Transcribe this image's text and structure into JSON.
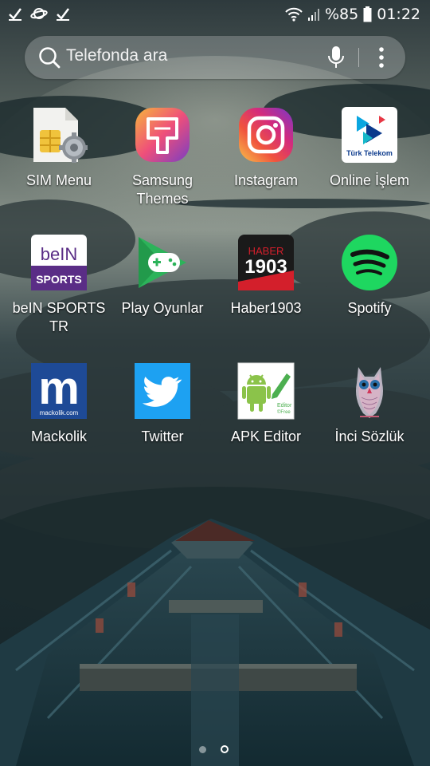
{
  "status_bar": {
    "notification_icons": [
      "check-icon",
      "planet-icon",
      "check-icon"
    ],
    "battery_percent": "%85",
    "time": "01:22"
  },
  "search": {
    "placeholder": "Telefonda ara"
  },
  "apps": [
    {
      "label": "SIM Menu",
      "icon": "sim-card-gear-icon"
    },
    {
      "label": "Samsung\nThemes",
      "icon": "paint-brush-icon"
    },
    {
      "label": "Instagram",
      "icon": "instagram-camera-icon"
    },
    {
      "label": "Online İşlem",
      "icon": "turk-telekom-logo-icon"
    },
    {
      "label": "beIN SPORTS\nTR",
      "icon": "bein-sports-logo-icon"
    },
    {
      "label": "Play Oyunlar",
      "icon": "gamepad-icon"
    },
    {
      "label": "Haber1903",
      "icon": "haber1903-logo-icon"
    },
    {
      "label": "Spotify",
      "icon": "spotify-logo-icon"
    },
    {
      "label": "Mackolik",
      "icon": "mackolik-logo-icon"
    },
    {
      "label": "Twitter",
      "icon": "twitter-bird-icon"
    },
    {
      "label": "APK Editor",
      "icon": "android-robot-icon"
    },
    {
      "label": "İnci Sözlük",
      "icon": "owl-icon"
    }
  ],
  "icon_texts": {
    "turk_telekom": "Türk Telekom",
    "bein_top": "beIN",
    "bein_bottom": "SPORTS",
    "haber_top": "HABER",
    "haber_bottom": "1903",
    "mackolik_letter": "m",
    "mackolik_domain": "mackolik.com",
    "apk_sub1": "Editor",
    "apk_sub2": "©Free"
  },
  "page_indicator": {
    "pages": 2,
    "current": 2
  }
}
